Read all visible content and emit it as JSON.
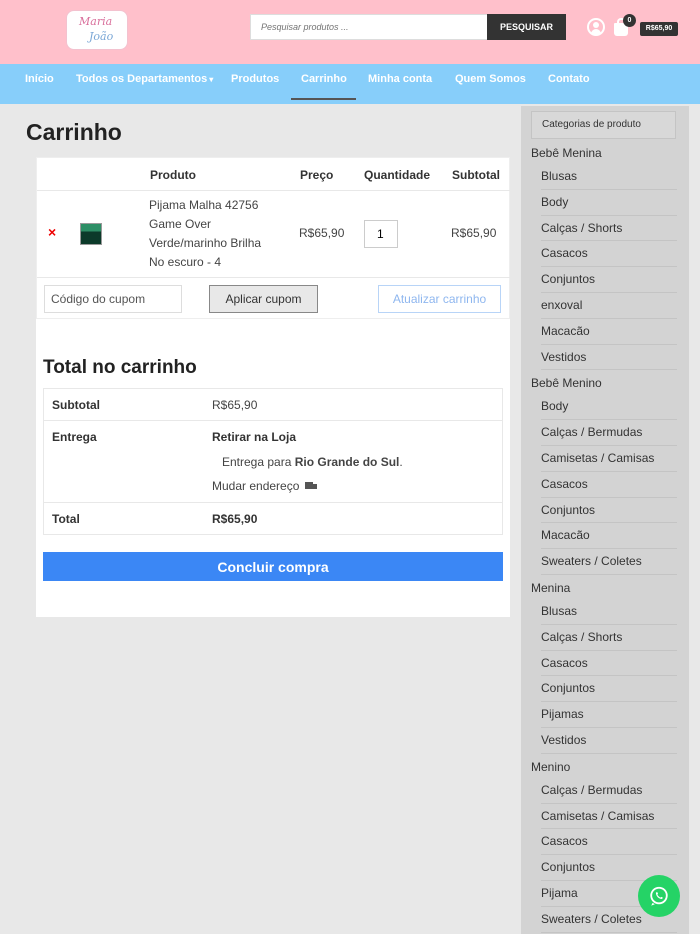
{
  "header": {
    "logo_line1": "Maria",
    "logo_line2": "João",
    "search_placeholder": "Pesquisar produtos ...",
    "search_button": "PESQUISAR",
    "cart_count": "0",
    "cart_total": "R$65,90"
  },
  "nav": {
    "items": [
      "Início",
      "Todos os Departamentos",
      "Produtos",
      "Carrinho",
      "Minha conta",
      "Quem Somos",
      "Contato"
    ],
    "dropdown_caret": "▾"
  },
  "page": {
    "title": "Carrinho"
  },
  "cart": {
    "headers": {
      "product": "Produto",
      "price": "Preço",
      "quantity": "Quantidade",
      "subtotal": "Subtotal"
    },
    "item": {
      "remove": "×",
      "name": "Pijama Malha 42756 Game Over Verde/marinho Brilha No escuro - 4",
      "price": "R$65,90",
      "quantity": "1",
      "subtotal": "R$65,90"
    },
    "coupon_placeholder": "Código do cupom",
    "apply_coupon": "Aplicar cupom",
    "update_cart": "Atualizar carrinho"
  },
  "totals": {
    "title": "Total no carrinho",
    "subtotal_label": "Subtotal",
    "subtotal_value": "R$65,90",
    "shipping_label": "Entrega",
    "shipping_method": "Retirar na Loja",
    "shipping_to_prefix": "Entrega para ",
    "shipping_state": "Rio Grande do Sul",
    "shipping_to_suffix": ".",
    "change_address": "Mudar endereço",
    "total_label": "Total",
    "total_value": "R$65,90",
    "checkout": "Concluir compra"
  },
  "sidebar": {
    "title": "Categorias de produto",
    "groups": [
      {
        "name": "Bebê Menina",
        "items": [
          "Blusas",
          "Body",
          "Calças / Shorts",
          "Casacos",
          "Conjuntos",
          "enxoval",
          "Macacão",
          "Vestidos"
        ]
      },
      {
        "name": "Bebê Menino",
        "items": [
          "Body",
          "Calças / Bermudas",
          "Camisetas / Camisas",
          "Casacos",
          "Conjuntos",
          "Macacão",
          "Sweaters / Coletes"
        ]
      },
      {
        "name": "Menina",
        "items": [
          "Blusas",
          "Calças / Shorts",
          "Casacos",
          "Conjuntos",
          "Pijamas",
          "Vestidos"
        ]
      },
      {
        "name": "Menino",
        "items": [
          "Calças / Bermudas",
          "Camisetas / Camisas",
          "Casacos",
          "Conjuntos",
          "Pijama",
          "Sweaters / Coletes"
        ]
      }
    ]
  },
  "colors": {
    "header_bg": "#ffc0cb",
    "nav_bg": "#87cefa",
    "checkout_bg": "#3b87f5",
    "whatsapp": "#25d366"
  },
  "icons": [
    "user-icon",
    "shopping-bag-icon",
    "remove-icon",
    "truck-icon",
    "whatsapp-icon"
  ]
}
